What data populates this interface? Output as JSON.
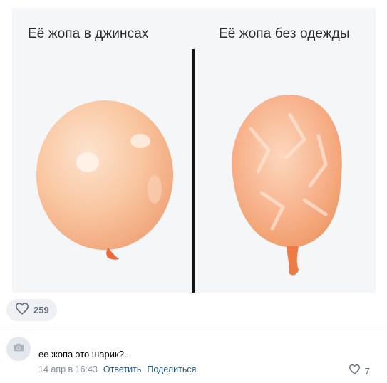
{
  "post": {
    "image": {
      "caption_left": "Её жопа в джинсах",
      "caption_right": "Её жопа без одежды"
    },
    "likes": {
      "count": "259",
      "icon": "heart-outline-icon"
    }
  },
  "comment": {
    "avatar_icon": "camera-icon",
    "text": "ее жопа это шарик?..",
    "date": "14 апр в 16:43",
    "reply_label": "Ответить",
    "share_label": "Поделиться",
    "likes": {
      "count": "7",
      "icon": "heart-outline-icon"
    }
  },
  "colors": {
    "link": "#2a5885",
    "secondary_text": "#818c99",
    "pill_bg": "#eef0f3",
    "balloon": "#f7b48a"
  }
}
